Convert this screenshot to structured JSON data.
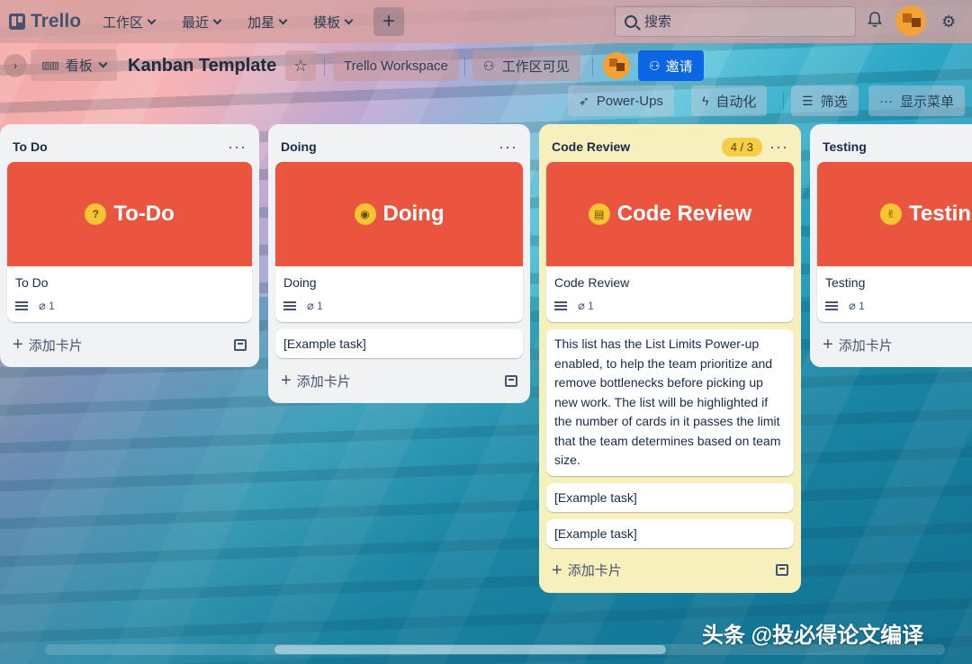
{
  "topnav": {
    "logo_text": "Trello",
    "items": [
      {
        "label": "工作区"
      },
      {
        "label": "最近"
      },
      {
        "label": "加星"
      },
      {
        "label": "模板"
      }
    ],
    "create_label": "+",
    "search_placeholder": "搜索"
  },
  "board": {
    "view_label": "看板",
    "title": "Kanban Template",
    "workspace_label": "Trello Workspace",
    "visibility_label": "工作区可见",
    "invite_label": "邀请",
    "powerups_label": "Power-Ups",
    "automation_label": "自动化",
    "filter_label": "筛选",
    "menu_label": "显示菜单"
  },
  "lists": [
    {
      "title": "To Do",
      "cards": [
        {
          "cover": "To-Do",
          "emoji": "🤔",
          "text": "To Do",
          "attachments": "1"
        }
      ],
      "add_label": "添加卡片"
    },
    {
      "title": "Doing",
      "cards": [
        {
          "cover": "Doing",
          "emoji": "🤓",
          "text": "Doing",
          "attachments": "1"
        },
        {
          "text": "[Example task]"
        }
      ],
      "add_label": "添加卡片"
    },
    {
      "title": "Code Review",
      "limit": "4 / 3",
      "cards": [
        {
          "cover": "Code Review",
          "emoji": "😬",
          "text": "Code Review",
          "attachments": "1"
        },
        {
          "text": "This list has the List Limits Power-up enabled, to help the team prioritize and remove bottlenecks before picking up new work. The list will be highlighted if the number of cards in it passes the limit that the team determines based on team size."
        },
        {
          "text": "[Example task]"
        },
        {
          "text": "[Example task]"
        }
      ],
      "add_label": "添加卡片"
    },
    {
      "title": "Testing",
      "cards": [
        {
          "cover": "Testing",
          "emoji": "🤞",
          "text": "Testing",
          "attachments": "1"
        }
      ],
      "add_label": "添加卡片"
    }
  ],
  "watermark": "头条 @投必得论文编译",
  "colors": {
    "card_cover": "#e9553f",
    "review_list_bg": "#f8f0bc",
    "invite_button": "#0c66e4",
    "limit_badge": "#f5cd47"
  }
}
